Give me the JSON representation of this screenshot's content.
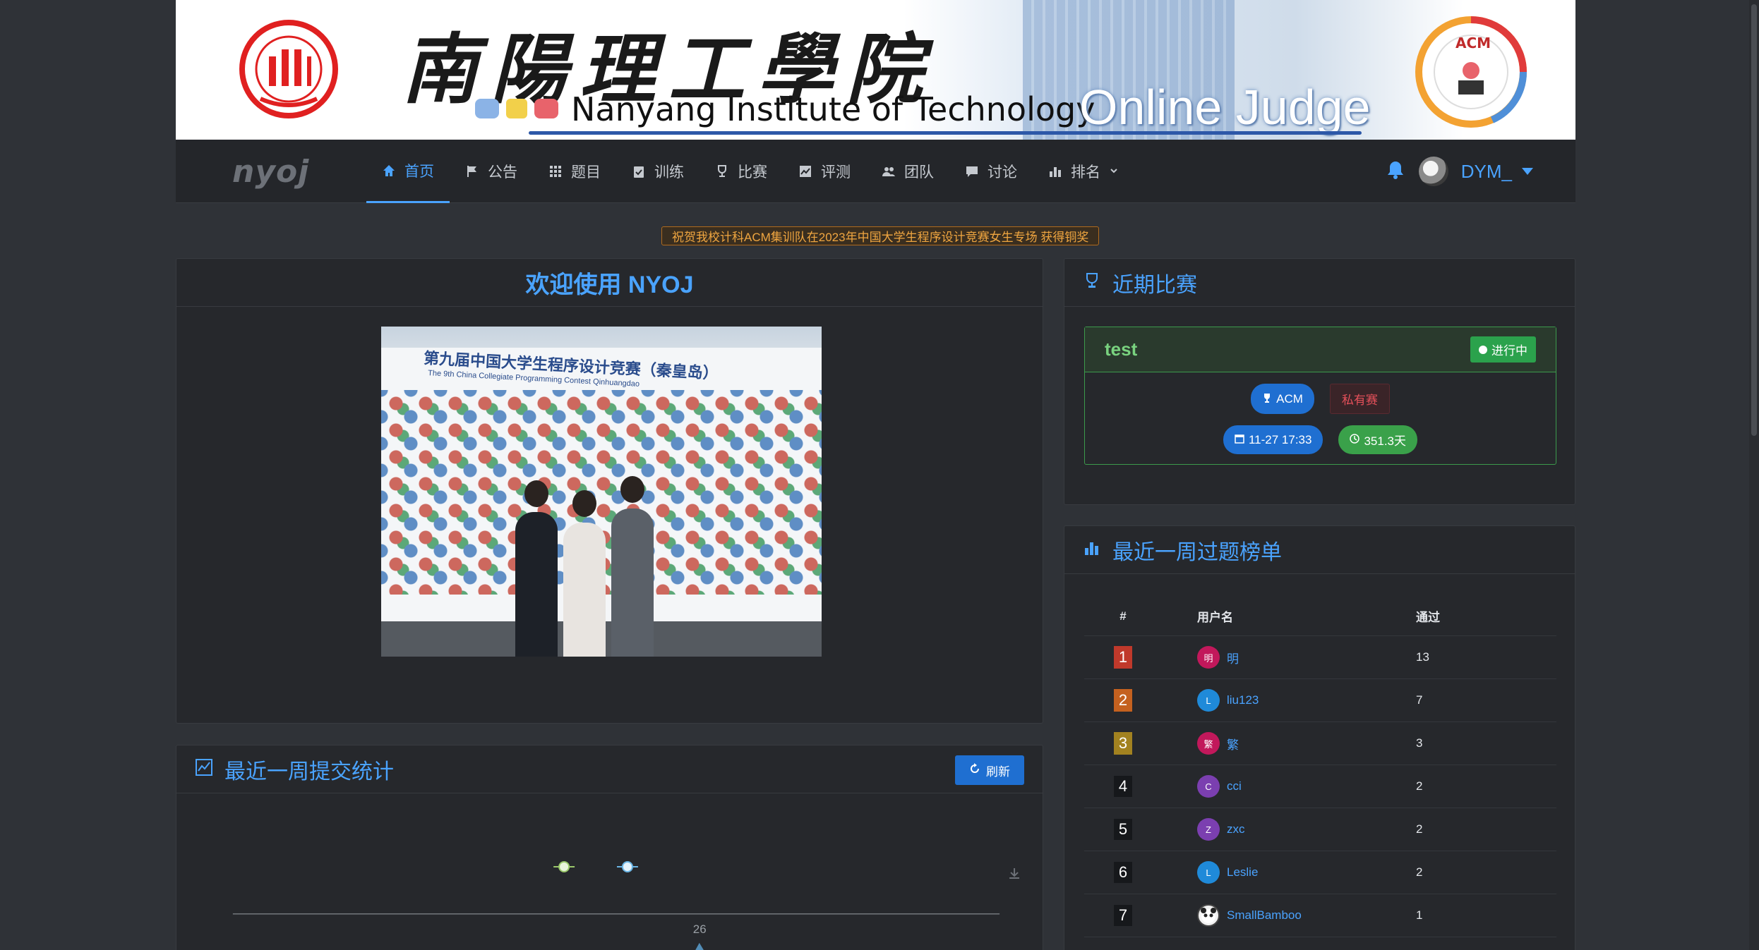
{
  "banner": {
    "cn_title": "南陽理工學院",
    "en_title": "Nanyang Institute of Technology",
    "oj_title": "Online Judge",
    "school_logo_icon": "nyist-seal-logo",
    "acm_logo_icon": "acm-club-logo"
  },
  "navbar": {
    "brand": "nyoj",
    "items": [
      {
        "label": "首页",
        "icon": "home-icon",
        "active": true
      },
      {
        "label": "公告",
        "icon": "flag-icon",
        "active": false
      },
      {
        "label": "题目",
        "icon": "grid-icon",
        "active": false
      },
      {
        "label": "训练",
        "icon": "clipboard-check-icon",
        "active": false
      },
      {
        "label": "比赛",
        "icon": "trophy-icon",
        "active": false
      },
      {
        "label": "评测",
        "icon": "chart-line-icon",
        "active": false
      },
      {
        "label": "团队",
        "icon": "users-icon",
        "active": false
      },
      {
        "label": "讨论",
        "icon": "comment-icon",
        "active": false
      },
      {
        "label": "排名",
        "icon": "bar-chart-icon",
        "active": false,
        "dropdown": true
      }
    ],
    "username": "DYM_"
  },
  "notice": {
    "text": "祝贺我校计科ACM集训队在2023年中国大学生程序设计竞赛女生专场 获得铜奖"
  },
  "welcome": {
    "title": "欢迎使用 NYOJ",
    "photo_wall_title": "第九届中国大学生程序设计竞赛（秦皇岛）",
    "photo_wall_subtitle": "The 9th China Collegiate Programming Contest Qinhuangdao"
  },
  "stats": {
    "title": "最近一周提交统计",
    "refresh_label": "刷新",
    "peak_label": "26"
  },
  "contests": {
    "title": "近期比赛",
    "items": [
      {
        "name": "test",
        "status": "进行中",
        "type": "ACM",
        "privacy": "私有赛",
        "start": "11-27 17:33",
        "duration": "351.3天"
      }
    ]
  },
  "ranking": {
    "title": "最近一周过题榜单",
    "columns": [
      "#",
      "用户名",
      "通过"
    ],
    "rows": [
      {
        "rank": "1",
        "initial": "明",
        "name": "明",
        "passed": "13",
        "color": "#c2185b"
      },
      {
        "rank": "2",
        "initial": "L",
        "name": "liu123",
        "passed": "7",
        "color": "#1f8ad9"
      },
      {
        "rank": "3",
        "initial": "繁",
        "name": "繁",
        "passed": "3",
        "color": "#c2185b"
      },
      {
        "rank": "4",
        "initial": "C",
        "name": "cci",
        "passed": "2",
        "color": "#7b3fb0"
      },
      {
        "rank": "5",
        "initial": "Z",
        "name": "zxc",
        "passed": "2",
        "color": "#7b3fb0"
      },
      {
        "rank": "6",
        "initial": "L",
        "name": "Leslie",
        "passed": "2",
        "color": "#1f8ad9"
      },
      {
        "rank": "7",
        "initial": "",
        "name": "SmallBamboo",
        "passed": "1",
        "color": "#f2f2f2"
      }
    ]
  }
}
